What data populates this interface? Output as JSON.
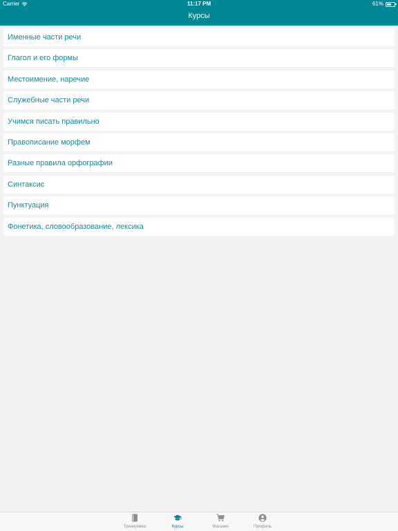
{
  "status_bar": {
    "carrier": "Carrier",
    "time": "11:17 PM",
    "battery": "61%",
    "battery_level": 0.61
  },
  "nav": {
    "title": "Курсы"
  },
  "courses": [
    {
      "label": "Именные части речи"
    },
    {
      "label": "Глагол и его формы"
    },
    {
      "label": "Местоимение, наречие"
    },
    {
      "label": "Служебные части речи"
    },
    {
      "label": "Учимся писать правильно"
    },
    {
      "label": "Правописание морфем"
    },
    {
      "label": "Разные правила орфографии"
    },
    {
      "label": "Синтаксис"
    },
    {
      "label": "Пунктуация"
    },
    {
      "label": "Фонетика, словообразование, лексика"
    }
  ],
  "tabbar": {
    "items": [
      {
        "label": "Тренировка",
        "icon": "book-icon",
        "active": false
      },
      {
        "label": "Курсы",
        "icon": "graduation-cap-icon",
        "active": true
      },
      {
        "label": "Магазин",
        "icon": "cart-icon",
        "active": false
      },
      {
        "label": "Профиль",
        "icon": "profile-icon",
        "active": false
      }
    ]
  },
  "colors": {
    "accent": "#008796",
    "row_text": "#13899a",
    "inactive": "#8e8e8e"
  }
}
